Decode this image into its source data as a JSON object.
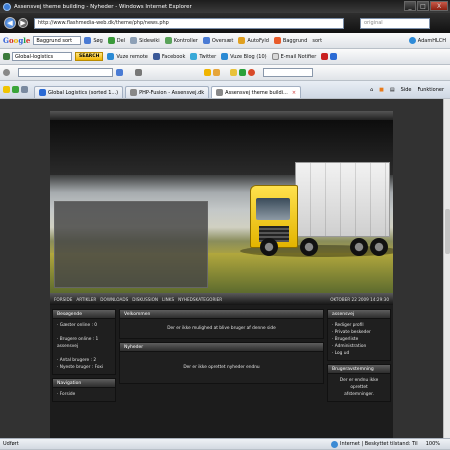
{
  "window": {
    "title": "Assensvej theme building - Nyheder - Windows Internet Explorer",
    "buttons": [
      "_",
      "□",
      "X"
    ]
  },
  "address": {
    "url": "http://www.flashmedia-web.dk/theme/php/news.php",
    "search_placeholder": "original"
  },
  "toolbar1": {
    "google_letters": [
      "G",
      "o",
      "o",
      "g",
      "l",
      "e"
    ],
    "search_value": "Baggrund sort",
    "items": [
      "Søg",
      "Del",
      "Sidewiki",
      "Kontroller",
      "Oversæt",
      "AutoFyld",
      "Baggrund",
      "sort",
      "AdamHLCH"
    ]
  },
  "toolbar2": {
    "company_value": "Global-logistics",
    "search_button": "SEARCH",
    "items": [
      "Vuze remote",
      "Facebook",
      "Twitter",
      "Vuze Blog (10)",
      "E-mail Notifier"
    ]
  },
  "toolbar3": {
    "items": [
      ""
    ]
  },
  "tabs": {
    "list": [
      "Global Logistics (sorted 1...)",
      "PHP-Fusion - Assensvej.dk",
      "Assensvej theme buildi..."
    ],
    "active_index": 2,
    "right": [
      "Side",
      "Funktioner"
    ]
  },
  "site": {
    "nav_links": [
      "FORSIDE",
      "ARTIKLER",
      "DOWNLOADS",
      "DISKUSSION",
      "LINKS",
      "NYHEDSKATEGORIER"
    ],
    "date": "OKTOBER 22 2009 14:29:30",
    "left_panels": [
      {
        "title": "Besøgende",
        "lines": [
          "Gæster online : 0",
          "",
          "Brugere online : 1",
          "assensvej",
          "",
          "Antal brugere : 2",
          "Nyeste bruger : Foxi"
        ]
      },
      {
        "title": "Navigation",
        "lines": [
          "Forside"
        ]
      }
    ],
    "center_panels": [
      {
        "title": "Velkommen",
        "text": "Der er ikke mulighed at blive bruger af denne side"
      },
      {
        "title": "Nyheder",
        "text": "Der er ikke oprettet nyheder endnu"
      }
    ],
    "right_panels": [
      {
        "title": "assensvej",
        "lines": [
          "Rediger profil",
          "Private beskeder",
          "Brugerliste",
          "Administration",
          "Log ud"
        ]
      },
      {
        "title": "Brugeravstemning",
        "lines": [
          "Der er endnu ikke oprettet",
          "afstemninger."
        ]
      }
    ]
  },
  "status": {
    "left": "Udført",
    "zone": "Internet | Beskyttet tilstand: Til",
    "zoom": "100%"
  }
}
